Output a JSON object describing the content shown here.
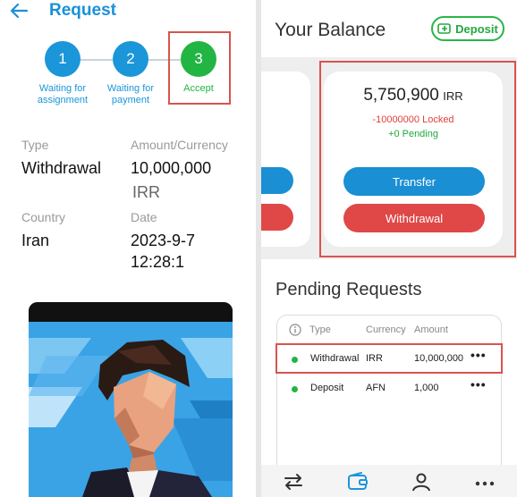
{
  "request": {
    "title": "Request",
    "steps": [
      {
        "number": "1",
        "label_line1": "Waiting for",
        "label_line2": "assignment",
        "status": "done"
      },
      {
        "number": "2",
        "label_line1": "Waiting for",
        "label_line2": "payment",
        "status": "done"
      },
      {
        "number": "3",
        "label_line1": "Accept",
        "label_line2": "",
        "status": "current"
      }
    ],
    "fields": {
      "type_label": "Type",
      "type_value": "Withdrawal",
      "amount_label": "Amount/Currency",
      "amount_value": "10,000,000",
      "currency_value": "IRR",
      "country_label": "Country",
      "country_value": "Iran",
      "date_label": "Date",
      "date_value": "2023-9-7",
      "time_value": "12:28:1"
    }
  },
  "balance": {
    "title": "Your Balance",
    "deposit_label": "Deposit",
    "amount": "5,750,900",
    "currency": "IRR",
    "locked_text": "-10000000 Locked",
    "pending_text": "+0 Pending",
    "transfer_label": "Transfer",
    "withdrawal_label": "Withdrawal"
  },
  "pending_requests": {
    "title": "Pending Requests",
    "headers": {
      "type": "Type",
      "currency": "Currency",
      "amount": "Amount"
    },
    "rows": [
      {
        "type": "Withdrawal",
        "currency": "IRR",
        "amount": "10,000,000"
      },
      {
        "type": "Deposit",
        "currency": "AFN",
        "amount": "1,000"
      }
    ]
  },
  "nav": {
    "icons": [
      "transfer-icon",
      "wallet-icon",
      "profile-icon",
      "more-icon"
    ],
    "active": "wallet-icon"
  },
  "colors": {
    "primary_blue": "#1a96d9",
    "success_green": "#22b543",
    "danger_red": "#e04848",
    "highlight_outline": "#d9534f"
  }
}
